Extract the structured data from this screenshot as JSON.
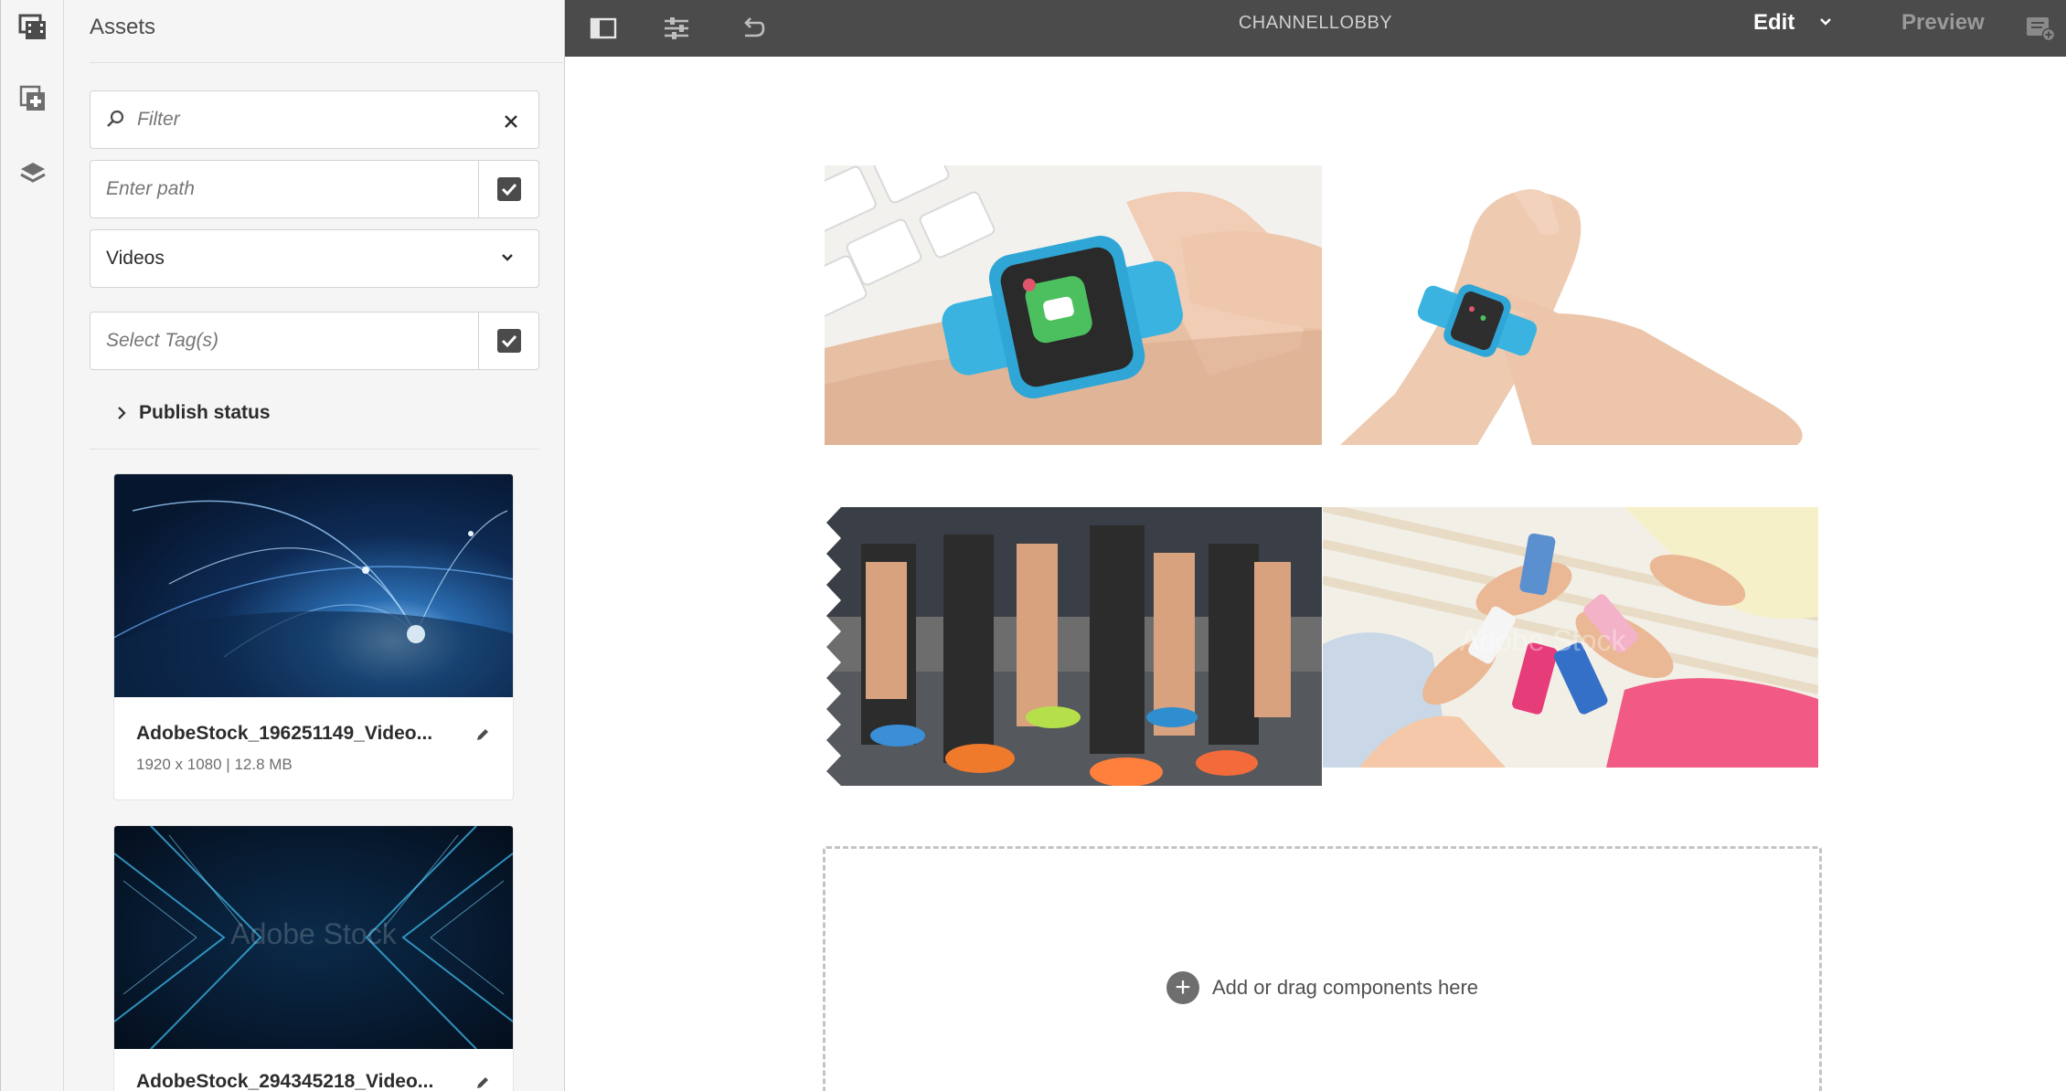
{
  "rail": {
    "items": [
      "assets-icon",
      "components-icon",
      "layers-icon"
    ]
  },
  "panel": {
    "title": "Assets",
    "filter": {
      "placeholder": "Filter"
    },
    "path": {
      "placeholder": "Enter path"
    },
    "type_select": {
      "value": "Videos"
    },
    "tags": {
      "placeholder": "Select Tag(s)"
    },
    "publish_status": "Publish status",
    "assets": [
      {
        "name": "AdobeStock_196251149_Video...",
        "meta": "1920 x 1080 | 12.8 MB"
      },
      {
        "name": "AdobeStock_294345218_Video...",
        "meta": ""
      }
    ]
  },
  "topbar": {
    "title": "CHANNELLOBBY",
    "mode": "Edit",
    "preview": "Preview"
  },
  "canvas": {
    "watermark": "Adobe Stock",
    "dropzone": "Add or drag components here"
  },
  "colors": {
    "topbar": "#4b4b4b",
    "panel": "#f5f5f5",
    "accent_blue": "#3ab0e0"
  }
}
